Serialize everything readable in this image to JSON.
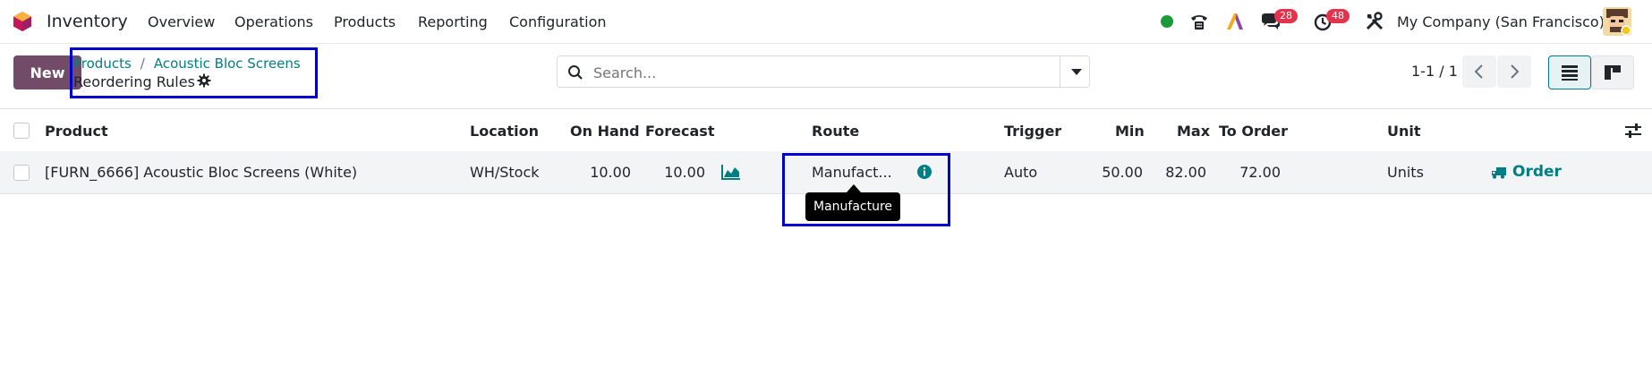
{
  "navbar": {
    "app_name": "Inventory",
    "menu": [
      "Overview",
      "Operations",
      "Products",
      "Reporting",
      "Configuration"
    ],
    "chat_badge": "28",
    "activity_badge": "48",
    "company": "My Company (San Francisco)",
    "status_color": "#1b9a3a"
  },
  "control": {
    "new_label": "New",
    "breadcrumb": [
      "Products",
      "Acoustic Bloc Screens"
    ],
    "title": "Reordering Rules",
    "search_placeholder": "Search...",
    "pager": "1-1 / 1"
  },
  "table": {
    "headers": {
      "product": "Product",
      "location": "Location",
      "on_hand": "On Hand",
      "forecast": "Forecast",
      "route": "Route",
      "trigger": "Trigger",
      "min": "Min",
      "max": "Max",
      "to_order": "To Order",
      "unit": "Unit"
    },
    "rows": [
      {
        "product": "[FURN_6666] Acoustic Bloc Screens (White)",
        "location": "WH/Stock",
        "on_hand": "10.00",
        "forecast": "10.00",
        "route": "Manufact...",
        "trigger": "Auto",
        "min": "50.00",
        "max": "82.00",
        "to_order": "72.00",
        "unit": "Units",
        "action": "Order"
      }
    ]
  },
  "tooltip": {
    "text": "Manufacture"
  },
  "colors": {
    "brand": "#714b67",
    "accent": "#017e84",
    "badge": "#e6334c",
    "highlight": "#0000cc"
  }
}
